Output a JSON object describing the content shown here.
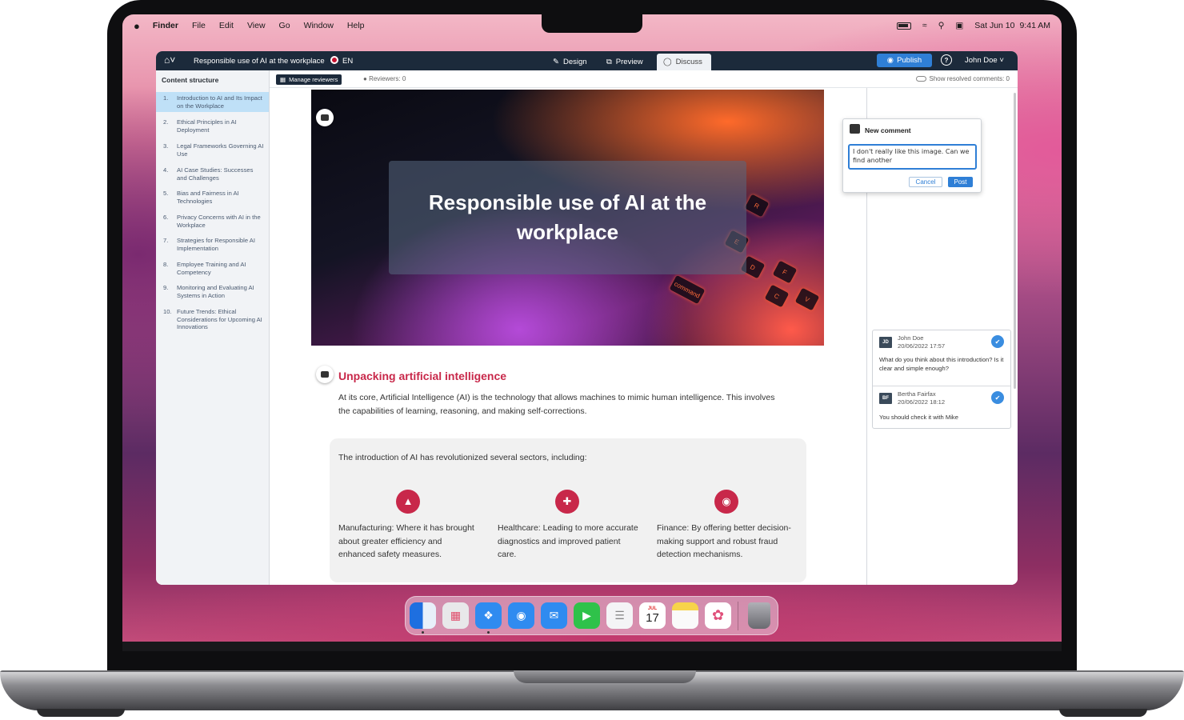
{
  "menubar": {
    "apple": "",
    "app": "Finder",
    "items": [
      "File",
      "Edit",
      "View",
      "Go",
      "Window",
      "Help"
    ],
    "date": "Sat Jun 10",
    "time": "9:41 AM"
  },
  "topbar": {
    "title": "Responsible use of AI at the workplace",
    "lang": "EN",
    "tabs": [
      {
        "label": "Design",
        "icon": "design-icon"
      },
      {
        "label": "Preview",
        "icon": "preview-icon"
      },
      {
        "label": "Discuss",
        "icon": "discuss-icon"
      }
    ],
    "publish": "Publish",
    "user": "John Doe"
  },
  "sidebar": {
    "header": "Content structure",
    "items": [
      {
        "num": "1.",
        "label": "Introduction to AI and Its Impact on the Workplace"
      },
      {
        "num": "2.",
        "label": "Ethical Principles in AI Deployment"
      },
      {
        "num": "3.",
        "label": "Legal Frameworks Governing AI Use"
      },
      {
        "num": "4.",
        "label": "AI Case Studies: Successes and Challenges"
      },
      {
        "num": "5.",
        "label": "Bias and Fairness in AI Technologies"
      },
      {
        "num": "6.",
        "label": "Privacy Concerns with AI in the Workplace"
      },
      {
        "num": "7.",
        "label": "Strategies for Responsible AI Implementation"
      },
      {
        "num": "8.",
        "label": "Employee Training and AI Competency"
      },
      {
        "num": "9.",
        "label": "Monitoring and Evaluating AI Systems in Action"
      },
      {
        "num": "10.",
        "label": "Future Trends: Ethical Considerations for Upcoming AI Innovations"
      }
    ]
  },
  "subbar": {
    "manage": "Manage reviewers",
    "reviewers": "Reviewers: 0",
    "resolved": "Show resolved comments: 0"
  },
  "hero": {
    "title": "Responsible use of AI at the workplace",
    "keys": [
      "R",
      "E",
      "D",
      "C",
      "F",
      "V",
      "command"
    ]
  },
  "section": {
    "heading": "Unpacking artificial intelligence",
    "paragraph": "At its core, Artificial Intelligence (AI) is the technology that allows machines to mimic human intelligence. This involves the capabilities of learning, reasoning, and making self-corrections."
  },
  "card": {
    "intro": "The introduction of AI has revolutionized several sectors, including:",
    "sectors": [
      {
        "icon": "hardhat-icon",
        "text": "Manufacturing: Where it has brought about greater efficiency and enhanced safety measures."
      },
      {
        "icon": "medical-monitor-icon",
        "text": "Healthcare: Leading to more accurate diagnostics and improved patient care."
      },
      {
        "icon": "piggy-bank-icon",
        "text": "Finance: By offering better decision-making support and robust fraud detection mechanisms."
      }
    ]
  },
  "new_comment": {
    "title": "New comment",
    "text": "I don't really like this image. Can we find another",
    "cancel": "Cancel",
    "post": "Post"
  },
  "comments": [
    {
      "initials": "JD",
      "author": "John Doe",
      "date": "20/06/2022 17:57",
      "text": "What do you think about this introduction? Is it clear and simple enough?"
    },
    {
      "initials": "BF",
      "author": "Bertha Fairfax",
      "date": "20/06/2022 18:12",
      "text": "You should check it with Mike"
    }
  ],
  "dock": {
    "apps": [
      {
        "name": "finder",
        "color": "#3a8ef0"
      },
      {
        "name": "launchpad",
        "color": "#e8e8ea"
      },
      {
        "name": "safari",
        "color": "#2f8bf0"
      },
      {
        "name": "messages",
        "color": "#27b14b"
      },
      {
        "name": "mail",
        "color": "#2f8bf0"
      },
      {
        "name": "facetime",
        "color": "#2fc24a"
      },
      {
        "name": "reminders",
        "color": "#f4f4f6"
      },
      {
        "name": "calendar",
        "color": "#ffffff",
        "month": "JUL",
        "day": "17"
      },
      {
        "name": "notes",
        "color": "#f7d34a"
      },
      {
        "name": "photos",
        "color": "#ffffff"
      },
      {
        "name": "trash",
        "color": "#9a9aa0"
      }
    ]
  },
  "colors": {
    "accent": "#c8284a",
    "primary": "#2f7fd6",
    "topbar": "#1c2a3b"
  }
}
